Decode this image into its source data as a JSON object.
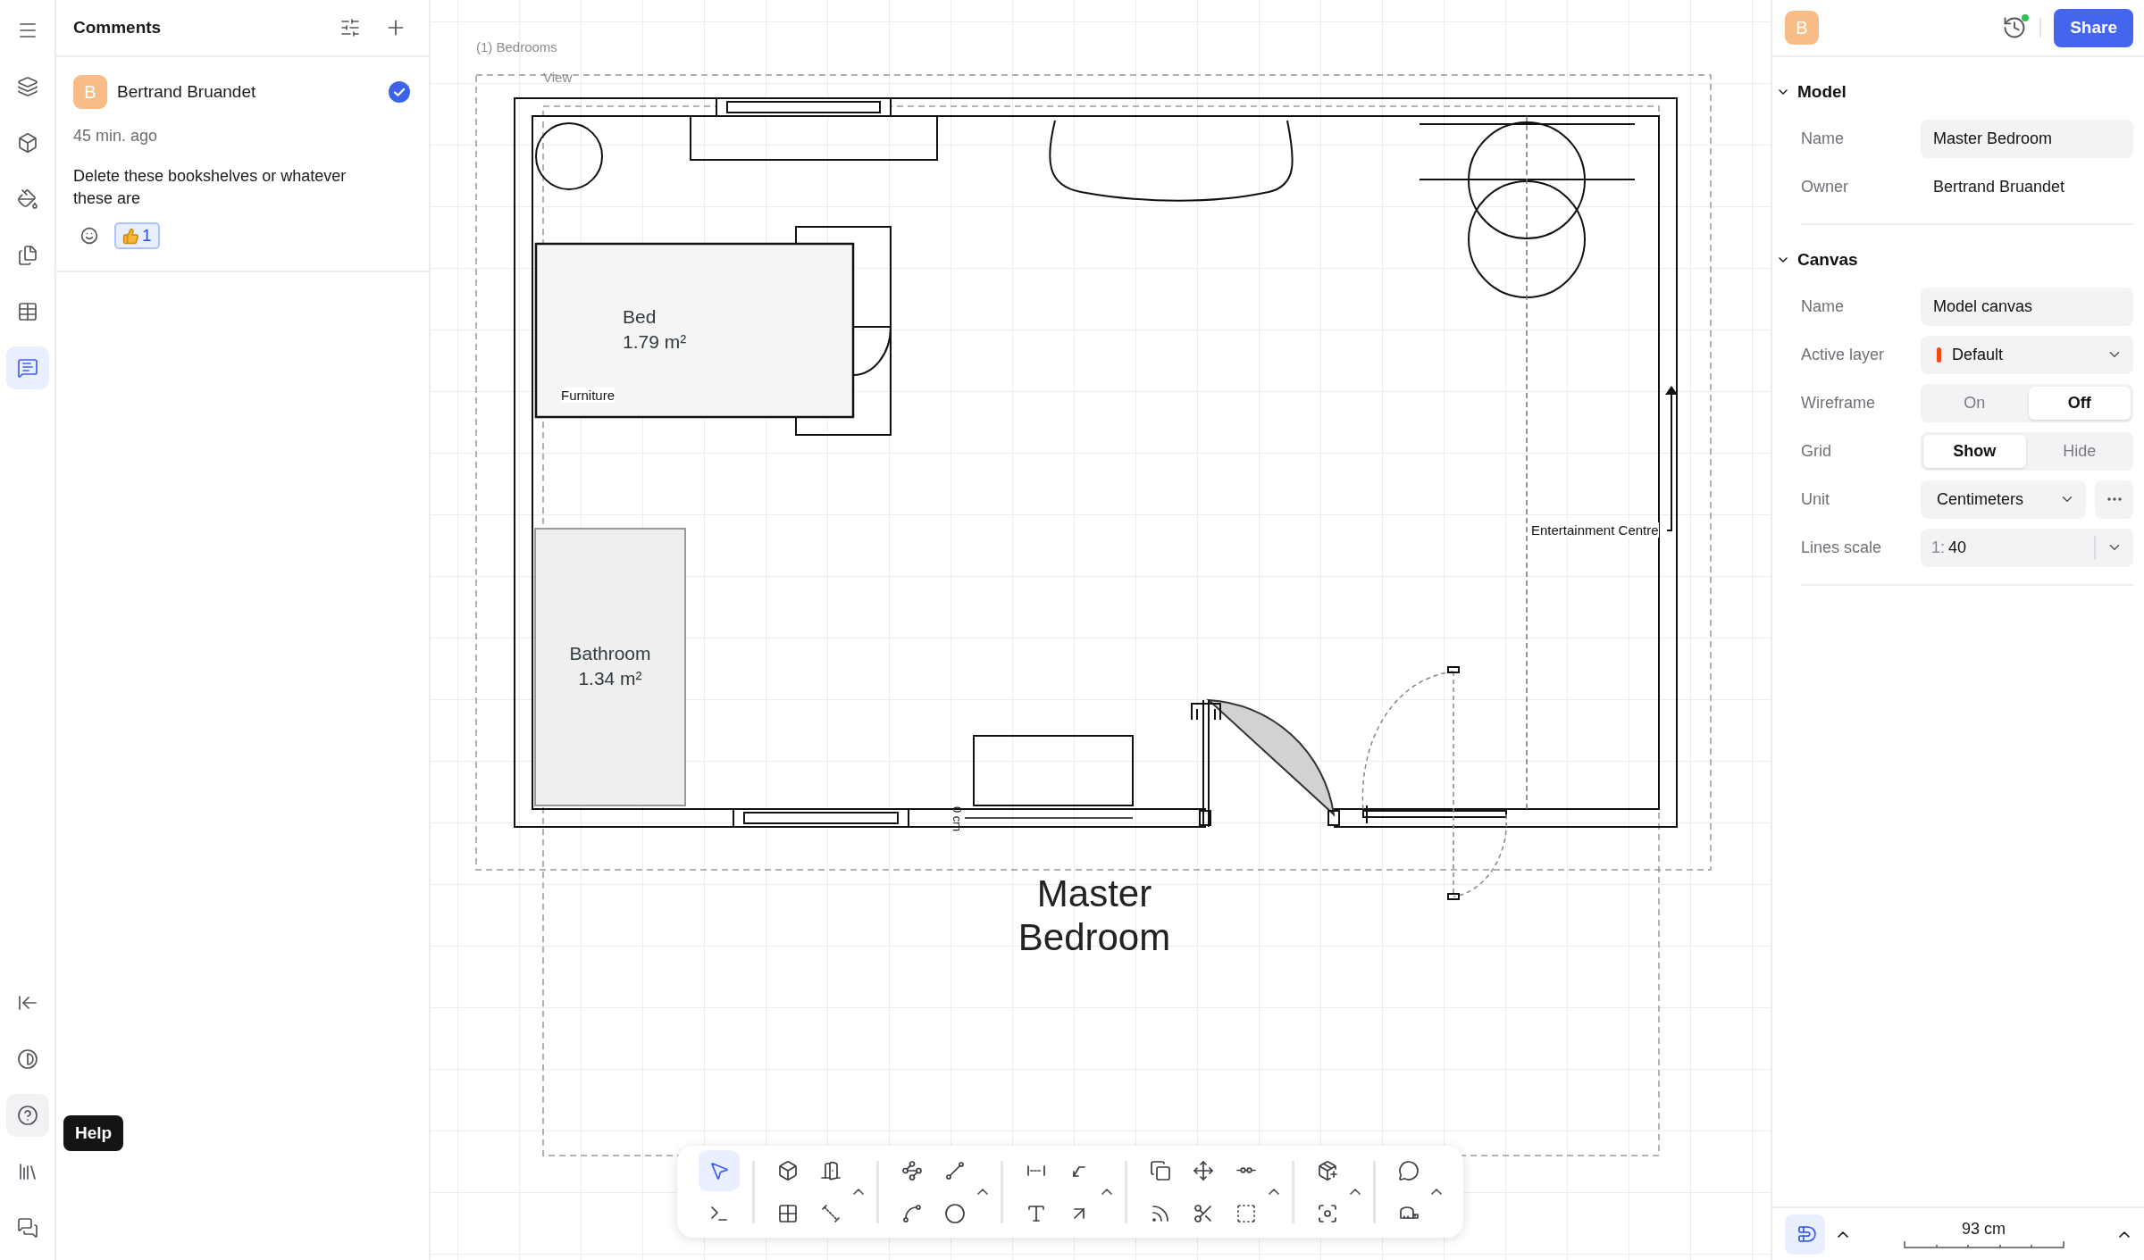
{
  "rail": {
    "top_items": [
      {
        "kind": "menu",
        "selected": false
      },
      {
        "kind": "layers",
        "selected": false
      },
      {
        "kind": "objects",
        "selected": false
      },
      {
        "kind": "styles",
        "selected": false
      },
      {
        "kind": "pages",
        "selected": false
      },
      {
        "kind": "tables",
        "selected": false
      },
      {
        "kind": "comments",
        "selected": true
      }
    ],
    "bottom_items": [
      {
        "kind": "collapse",
        "hovered": false
      },
      {
        "kind": "theme",
        "hovered": false
      },
      {
        "kind": "help",
        "hovered": true
      },
      {
        "kind": "library",
        "hovered": false
      },
      {
        "kind": "feedback",
        "hovered": false
      }
    ],
    "tooltip": "Help"
  },
  "comments_panel": {
    "title": "Comments",
    "comments": [
      {
        "initial": "B",
        "author": "Bertrand Bruandet",
        "resolved": true,
        "time": "45 min. ago",
        "text": "Delete these bookshelves or whatever these are",
        "reactions": [
          {
            "count": "1",
            "selected": true
          }
        ]
      }
    ]
  },
  "canvas": {
    "view_name": "(1) Bedrooms",
    "frame_label": "View",
    "title": "Master Bedroom",
    "labels": [
      {
        "kind": "room",
        "name": "Bed",
        "area": "1.79 m²"
      },
      {
        "kind": "tag",
        "text": "Furniture"
      },
      {
        "kind": "room",
        "name": "Bathroom",
        "area": "1.34 m²"
      },
      {
        "kind": "tag",
        "text": "Entertainment Centre"
      },
      {
        "kind": "dimension",
        "text": "0 cm"
      }
    ]
  },
  "toolbar": {
    "groups": [
      {
        "more": false,
        "tools": [
          {
            "kind": "select",
            "selected": true
          },
          {
            "kind": "terminal",
            "selected": false
          }
        ]
      },
      {
        "more": true,
        "tools": [
          {
            "kind": "wall",
            "selected": false
          },
          {
            "kind": "door",
            "selected": false
          },
          {
            "kind": "floor",
            "selected": false
          },
          {
            "kind": "measure",
            "selected": false
          }
        ]
      },
      {
        "more": true,
        "tools": [
          {
            "kind": "polyline",
            "selected": false
          },
          {
            "kind": "line",
            "selected": false
          },
          {
            "kind": "arc",
            "selected": false
          },
          {
            "kind": "circle",
            "selected": false
          }
        ]
      },
      {
        "more": true,
        "tools": [
          {
            "kind": "dimension",
            "selected": false
          },
          {
            "kind": "label",
            "selected": false
          },
          {
            "kind": "text",
            "selected": false
          },
          {
            "kind": "arrow",
            "selected": false
          }
        ]
      },
      {
        "more": true,
        "tools": [
          {
            "kind": "copy",
            "selected": false
          },
          {
            "kind": "move",
            "selected": false
          },
          {
            "kind": "split",
            "selected": false
          },
          {
            "kind": "offset",
            "selected": false
          },
          {
            "kind": "cut",
            "selected": false
          },
          {
            "kind": "frame",
            "selected": false
          }
        ]
      },
      {
        "more": true,
        "tools": [
          {
            "kind": "add_object",
            "selected": false
          },
          {
            "kind": "scan",
            "selected": false
          }
        ]
      },
      {
        "more": true,
        "tools": [
          {
            "kind": "comment",
            "selected": false
          },
          {
            "kind": "tape",
            "selected": false
          }
        ]
      }
    ]
  },
  "right_panel": {
    "avatar": "B",
    "history_activity": true,
    "share": "Share",
    "sections": [
      {
        "title": "Model",
        "expanded": true,
        "rows": [
          {
            "kind": "input",
            "label": "Name",
            "value": "Master Bedroom"
          },
          {
            "kind": "text",
            "label": "Owner",
            "value": "Bertrand Bruandet"
          }
        ]
      },
      {
        "title": "Canvas",
        "expanded": true,
        "rows": [
          {
            "kind": "input",
            "label": "Name",
            "value": "Model canvas"
          },
          {
            "kind": "select",
            "label": "Active layer",
            "value": "Default",
            "color": "#f04b16"
          },
          {
            "kind": "segmented",
            "label": "Wireframe",
            "options": [
              {
                "label": "On",
                "selected": false
              },
              {
                "label": "Off",
                "selected": true
              }
            ]
          },
          {
            "kind": "segmented",
            "label": "Grid",
            "options": [
              {
                "label": "Show",
                "selected": true
              },
              {
                "label": "Hide",
                "selected": false
              }
            ]
          },
          {
            "kind": "select_more",
            "label": "Unit",
            "value": "Centimeters"
          },
          {
            "kind": "scale",
            "label": "Lines scale",
            "prefix": "1:",
            "value": "40"
          }
        ]
      }
    ]
  },
  "footer": {
    "snap_selected": true,
    "scale_reading": "93 cm"
  }
}
